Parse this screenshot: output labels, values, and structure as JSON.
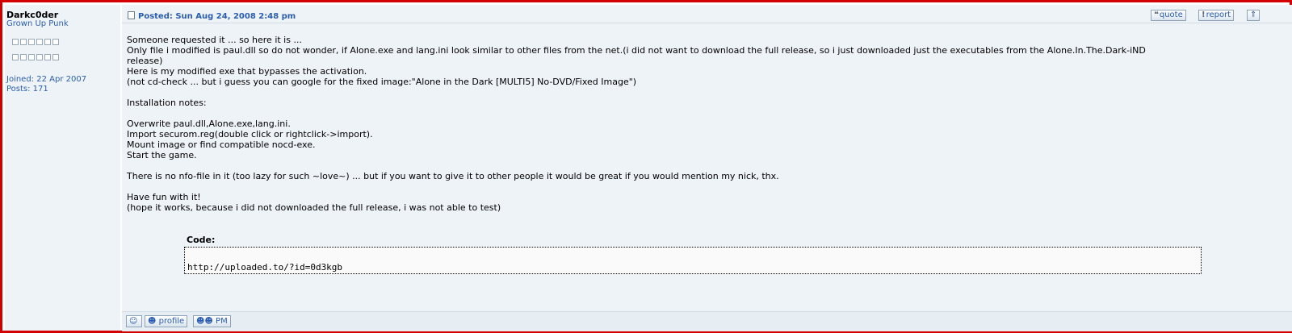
{
  "author": {
    "name": "Darkc0der",
    "rank": "Grown Up Punk",
    "joined": "Joined: 22 Apr 2007",
    "posts": "Posts: 171"
  },
  "post": {
    "posted": "Posted: Sun Aug 24, 2008 2:48 pm",
    "buttons": {
      "quote": "quote",
      "report": "report",
      "top": "⇑"
    },
    "lines": [
      "Someone requested it ... so here it is ...",
      "Only file i modified is paul.dll so do not wonder, if Alone.exe and lang.ini look similar to other files from the net.(i did not want to download the full release, so i just downloaded just the executables from the Alone.In.The.Dark-iND",
      "release)",
      "Here is my modified exe that bypasses the activation.",
      "(not cd-check ... but i guess you can google for the fixed image:\"Alone in the Dark [MULTI5] No-DVD/Fixed Image\")",
      "",
      "Installation notes:",
      "",
      "Overwrite paul.dll,Alone.exe,lang.ini.",
      "Import securom.reg(double click or rightclick->import).",
      "Mount image or find compatible nocd-exe.",
      "Start the game.",
      "",
      "There is no nfo-file in it (too lazy for such ~love~) ... but if you want to give it to other people it would be great if you would mention my nick, thx.",
      "",
      "Have fun with it!",
      "(hope it works, because i did not downloaded the full release, i was not able to test)"
    ],
    "code_label": "Code:",
    "code": "http://uploaded.to/?id=0d3kgb"
  },
  "footer": {
    "profile": "profile",
    "pm": "PM"
  }
}
